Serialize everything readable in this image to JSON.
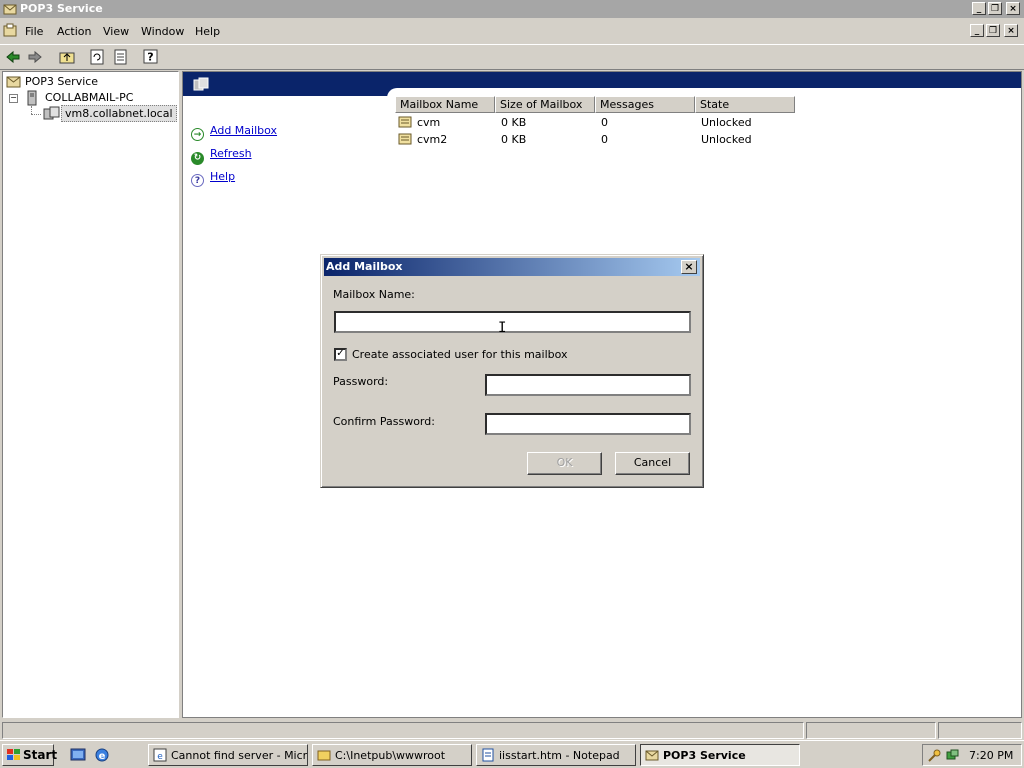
{
  "window": {
    "title": "POP3 Service"
  },
  "menu": {
    "items": [
      {
        "label": "File"
      },
      {
        "label": "Action"
      },
      {
        "label": "View"
      },
      {
        "label": "Window"
      },
      {
        "label": "Help"
      }
    ]
  },
  "tree": {
    "root": "POP3 Service",
    "server": "COLLABMAIL-PC",
    "domain": "vm8.collabnet.local"
  },
  "tasks": [
    {
      "label": "Add Mailbox",
      "icon": "arrow-right-icon"
    },
    {
      "label": "Refresh",
      "icon": "refresh-icon"
    },
    {
      "label": "Help",
      "icon": "help-icon"
    }
  ],
  "mailboxes": {
    "columns": [
      "Mailbox Name",
      "Size of Mailbox",
      "Messages",
      "State"
    ],
    "rows": [
      {
        "name": "cvm",
        "size": "0 KB",
        "messages": "0",
        "state": "Unlocked"
      },
      {
        "name": "cvm2",
        "size": "0 KB",
        "messages": "0",
        "state": "Unlocked"
      }
    ]
  },
  "dialog": {
    "title": "Add Mailbox",
    "mailbox_name_label": "Mailbox Name:",
    "mailbox_name_value": "",
    "create_user_label": "Create associated user for this mailbox",
    "create_user_checked": true,
    "password_label": "Password:",
    "confirm_password_label": "Confirm Password:",
    "ok_label": "OK",
    "cancel_label": "Cancel"
  },
  "taskbar": {
    "start_label": "Start",
    "buttons": [
      {
        "label": "Cannot find server - Micr...",
        "active": false
      },
      {
        "label": "C:\\Inetpub\\wwwroot",
        "active": false
      },
      {
        "label": "iisstart.htm - Notepad",
        "active": false
      },
      {
        "label": "POP3 Service",
        "active": true
      }
    ],
    "clock": "7:20 PM"
  },
  "colors": {
    "header_blue": "#0a246a",
    "link": "#0000cc",
    "face": "#d4d0c8"
  }
}
